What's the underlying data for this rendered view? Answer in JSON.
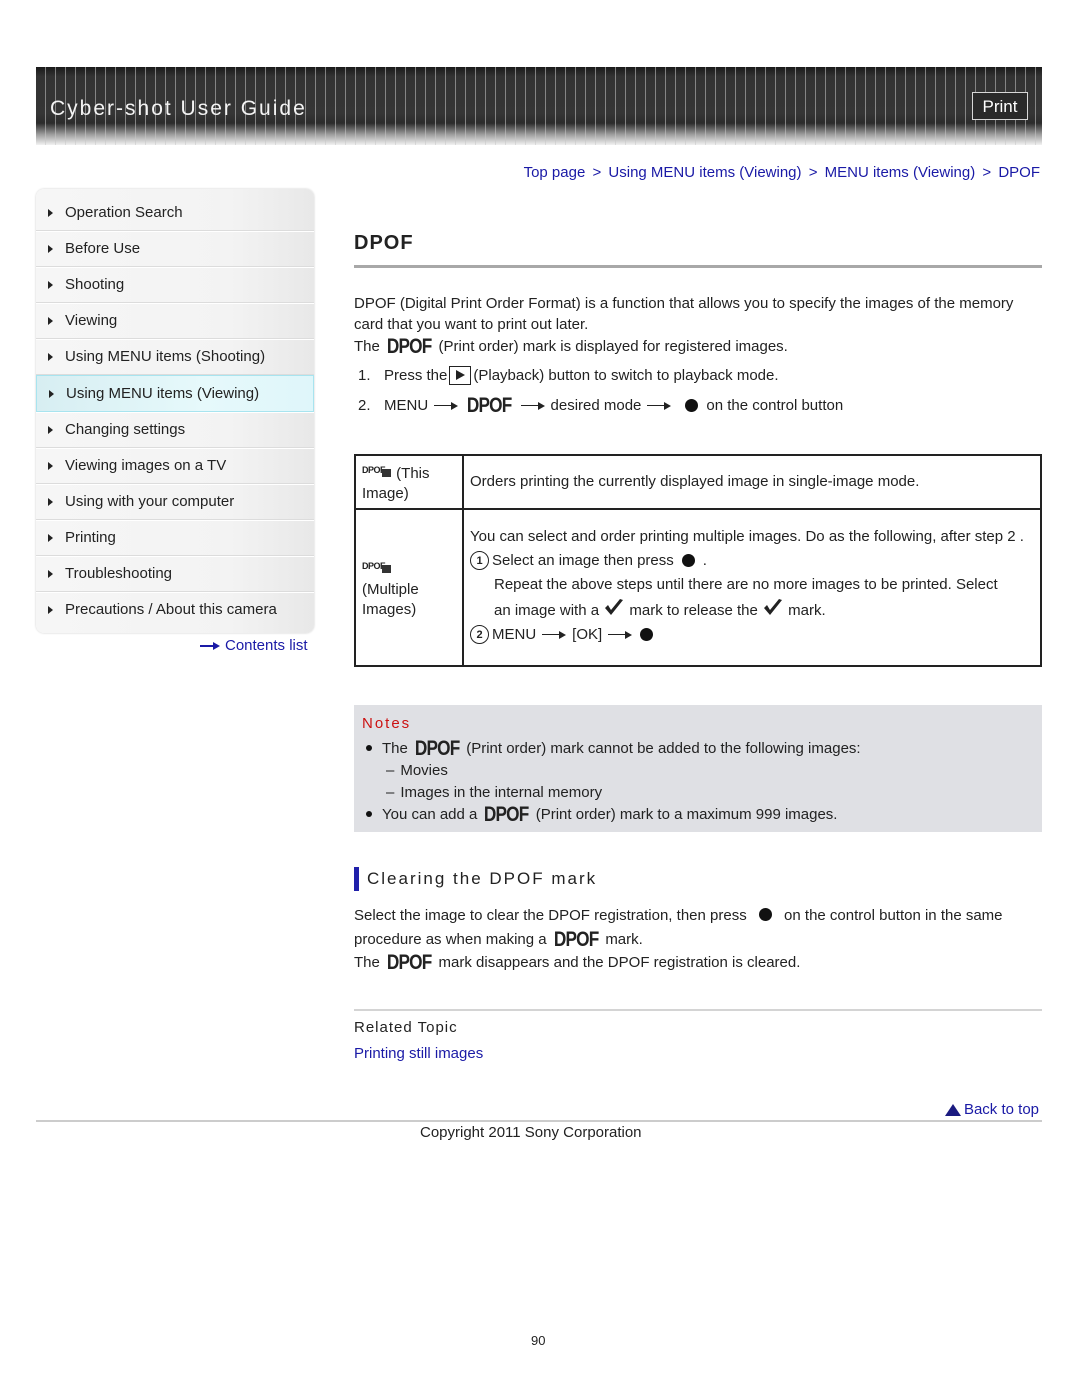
{
  "header": {
    "title": "Cyber-shot User Guide",
    "print_label": "Print"
  },
  "breadcrumb": {
    "items": [
      "Top page",
      "Using MENU items (Viewing)",
      "MENU items (Viewing)",
      "DPOF"
    ],
    "separator": ">"
  },
  "sidebar": {
    "items": [
      {
        "label": "Operation Search",
        "active": false
      },
      {
        "label": "Before Use",
        "active": false
      },
      {
        "label": "Shooting",
        "active": false
      },
      {
        "label": "Viewing",
        "active": false
      },
      {
        "label": "Using MENU items (Shooting)",
        "active": false
      },
      {
        "label": "Using MENU items (Viewing)",
        "active": true
      },
      {
        "label": "Changing settings",
        "active": false
      },
      {
        "label": "Viewing images on a TV",
        "active": false
      },
      {
        "label": "Using with your computer",
        "active": false
      },
      {
        "label": "Printing",
        "active": false
      },
      {
        "label": "Troubleshooting",
        "active": false
      },
      {
        "label": "Precautions / About this camera",
        "active": false
      }
    ],
    "contents_link": "Contents list"
  },
  "main": {
    "title": "DPOF",
    "dpof_mark": "DPOF",
    "intro": "DPOF (Digital Print Order Format) is a function that allows you to specify the images of the memory card that you want to print out later.",
    "mark_line": {
      "before": "The",
      "after": "(Print order) mark is displayed for registered images."
    },
    "steps": [
      {
        "num": "1.",
        "before": "Press the",
        "after": "(Playback) button to switch to playback mode."
      },
      {
        "num": "2.",
        "menu": "MENU",
        "mode": "desired mode",
        "after": "on the control button"
      }
    ],
    "table": {
      "rows": [
        {
          "icon_text": "DPOF",
          "label": "(This Image)",
          "description": "Orders printing the currently displayed image in single-image mode."
        },
        {
          "icon_text": "DPOF",
          "label": "(Multiple Images)",
          "description": "You can select and order printing multiple images. Do as the following, after step 2 .",
          "sub1_num": "1",
          "sub1": "Select an image then press",
          "sub1_end": ".",
          "repeat": "Repeat the above steps until there are no more images to be printed. Select",
          "release_a": "an image with a",
          "release_b": "mark to release the",
          "release_c": "mark.",
          "sub2_num": "2",
          "sub2_menu": "MENU",
          "sub2_ok": "[OK]"
        }
      ]
    }
  },
  "notes": {
    "title": "Notes",
    "note1_before": "The",
    "note1_after": "(Print order) mark cannot be added to the following images:",
    "dash_items": [
      "Movies",
      "Images in the internal memory"
    ],
    "dash": "–",
    "note2_before": "You can add a",
    "note2_after": "(Print order) mark to a maximum 999 images."
  },
  "clearing": {
    "heading": "Clearing the DPOF mark",
    "line1": "Select the image to clear the DPOF registration, then press",
    "line1_after": "on the control button in the same",
    "line2_before": "procedure as when making a",
    "line2_after": "mark.",
    "line3_before": "The",
    "line3_after": "mark disappears and the DPOF registration is cleared."
  },
  "related": {
    "title": "Related Topic",
    "link": "Printing still images"
  },
  "footer": {
    "back_to_top": "Back to top",
    "copyright": "Copyright 2011 Sony Corporation",
    "page_number": "90"
  },
  "colors": {
    "link": "#1a1aa6",
    "notes_title": "#cc1111",
    "notes_bg": "#dfe0e4",
    "active_nav": "#dff6fa",
    "heading_bar": "#2020aa"
  }
}
